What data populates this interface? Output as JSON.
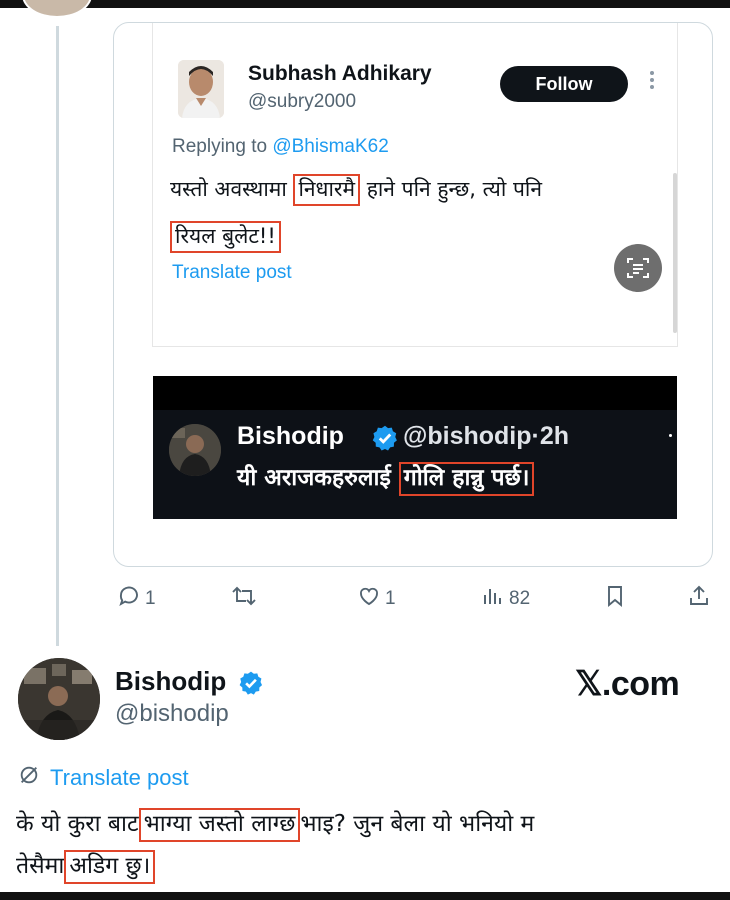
{
  "quoted_post": {
    "author_name": "Subhash Adhikary",
    "author_handle": "@subry2000",
    "follow_label": "Follow",
    "replying_prefix": "Replying to ",
    "replying_mention": "@BhismaK62",
    "text_line1_pre": "यस्तो अवस्थामा ",
    "text_line1_highlight": "निधारमै",
    "text_line1_post": " हाने पनि हुन्छ, त्यो पनि",
    "text_line2_highlight": "रियल बुलेट!!",
    "translate_label": "Translate post"
  },
  "embedded_screenshot": {
    "author_name": "Bishodip",
    "author_handle": "@bishodip·2h",
    "text_pre": "यी अराजकहरुलाई ",
    "text_highlight": "गोलि हान्नु पर्छ।"
  },
  "actions": {
    "reply_count": "1",
    "repost_count": "",
    "like_count": "1",
    "views_count": "82"
  },
  "main_post": {
    "author_name": "Bishodip",
    "author_handle": "@bishodip",
    "watermark": "𝕏.com",
    "translate_label": "Translate post",
    "text_line1_pre": "के यो कुरा बाट",
    "text_line1_highlight": "भाग्या जस्तो लाग्छ",
    "text_line1_post": "भाइ? जुन बेला यो भनियो म",
    "text_line2_pre": "तेसैमा",
    "text_line2_highlight": "अडिग छु।"
  },
  "colors": {
    "accent": "#1d9bf0",
    "highlight_box": "#e0452a",
    "text_primary": "#0f1419",
    "text_secondary": "#536471",
    "follow_bg": "#0f1419"
  },
  "icons": [
    "reply-icon",
    "repost-icon",
    "like-icon",
    "views-icon",
    "bookmark-icon",
    "share-icon",
    "verified-badge-icon",
    "translate-icon",
    "scan-text-icon",
    "more-icon"
  ]
}
